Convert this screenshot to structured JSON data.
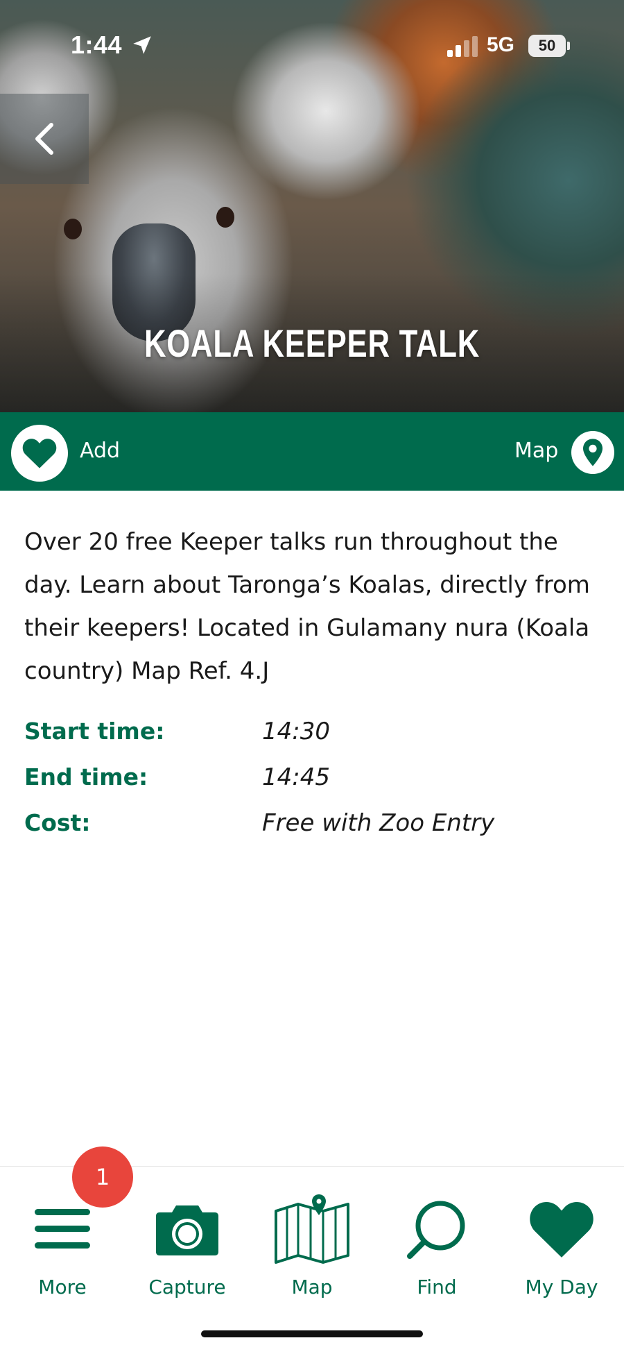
{
  "status_bar": {
    "time": "1:44",
    "network": "5G",
    "battery": "50"
  },
  "hero": {
    "title": "KOALA KEEPER TALK"
  },
  "actions": {
    "add_label": "Add",
    "map_label": "Map"
  },
  "event": {
    "description": "Over 20 free Keeper talks run throughout the day. Learn about Taronga’s Koalas, directly from their keepers! Located in Gulamany nura (Koala country) Map Ref. 4.J",
    "details": [
      {
        "label": "Start time:",
        "value": "14:30"
      },
      {
        "label": "End time:",
        "value": "14:45"
      },
      {
        "label": "Cost:",
        "value": "Free with Zoo Entry"
      }
    ]
  },
  "tab_bar": {
    "items": [
      {
        "label": "More",
        "icon": "menu-icon"
      },
      {
        "label": "Capture",
        "icon": "camera-icon"
      },
      {
        "label": "Map",
        "icon": "map-icon"
      },
      {
        "label": "Find",
        "icon": "search-icon"
      },
      {
        "label": "My Day",
        "icon": "heart-icon"
      }
    ],
    "badge_count": "1"
  },
  "colors": {
    "brand_green": "#006b4d",
    "badge_red": "#e8453c"
  }
}
